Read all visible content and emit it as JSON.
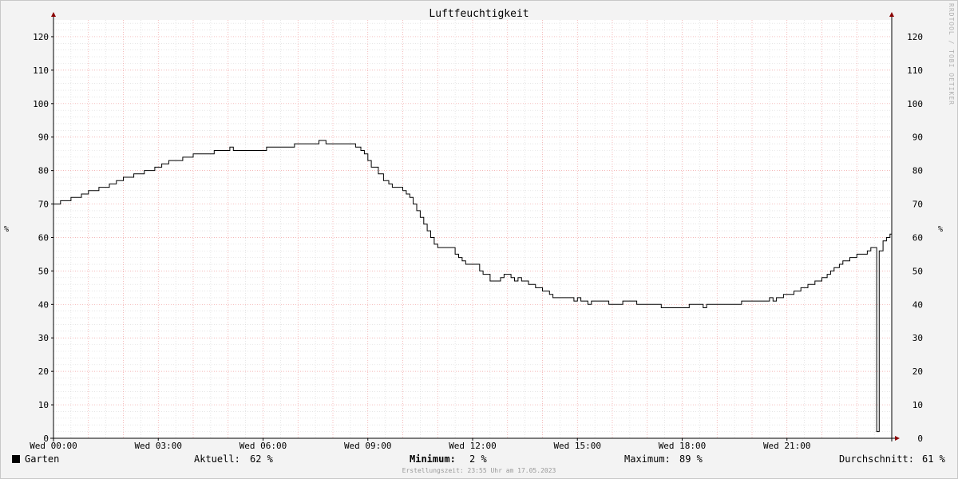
{
  "chart_data": {
    "type": "line",
    "title": "Luftfeuchtigkeit",
    "ylabel": "%",
    "ylim": [
      0,
      125
    ],
    "y_ticks": [
      0,
      10,
      20,
      30,
      40,
      50,
      60,
      70,
      80,
      90,
      100,
      110,
      120
    ],
    "x_range_hours": [
      0,
      24
    ],
    "x_ticks": [
      {
        "hour": 0,
        "label": "Wed 00:00"
      },
      {
        "hour": 3,
        "label": "Wed 03:00"
      },
      {
        "hour": 6,
        "label": "Wed 06:00"
      },
      {
        "hour": 9,
        "label": "Wed 09:00"
      },
      {
        "hour": 12,
        "label": "Wed 12:00"
      },
      {
        "hour": 15,
        "label": "Wed 15:00"
      },
      {
        "hour": 18,
        "label": "Wed 18:00"
      },
      {
        "hour": 21,
        "label": "Wed 21:00"
      }
    ],
    "grid": true,
    "series": [
      {
        "name": "Garten",
        "color": "#000000",
        "points": [
          [
            0.0,
            70
          ],
          [
            0.2,
            71
          ],
          [
            0.5,
            72
          ],
          [
            0.8,
            73
          ],
          [
            1.0,
            74
          ],
          [
            1.3,
            75
          ],
          [
            1.6,
            76
          ],
          [
            1.8,
            77
          ],
          [
            2.0,
            78
          ],
          [
            2.3,
            79
          ],
          [
            2.6,
            80
          ],
          [
            2.9,
            81
          ],
          [
            3.1,
            82
          ],
          [
            3.3,
            83
          ],
          [
            3.7,
            84
          ],
          [
            4.0,
            85
          ],
          [
            4.5,
            85
          ],
          [
            4.6,
            86
          ],
          [
            5.0,
            86
          ],
          [
            5.05,
            87
          ],
          [
            5.15,
            86
          ],
          [
            6.0,
            86
          ],
          [
            6.1,
            87
          ],
          [
            6.8,
            87
          ],
          [
            6.9,
            88
          ],
          [
            7.5,
            88
          ],
          [
            7.6,
            89
          ],
          [
            7.8,
            88
          ],
          [
            8.5,
            88
          ],
          [
            8.65,
            87
          ],
          [
            8.8,
            86
          ],
          [
            8.9,
            85
          ],
          [
            9.0,
            83
          ],
          [
            9.1,
            81
          ],
          [
            9.3,
            79
          ],
          [
            9.45,
            77
          ],
          [
            9.6,
            76
          ],
          [
            9.7,
            75
          ],
          [
            9.9,
            75
          ],
          [
            10.0,
            74
          ],
          [
            10.1,
            73
          ],
          [
            10.2,
            72
          ],
          [
            10.3,
            70
          ],
          [
            10.4,
            68
          ],
          [
            10.5,
            66
          ],
          [
            10.6,
            64
          ],
          [
            10.7,
            62
          ],
          [
            10.8,
            60
          ],
          [
            10.9,
            58
          ],
          [
            11.0,
            57
          ],
          [
            11.4,
            57
          ],
          [
            11.5,
            55
          ],
          [
            11.6,
            54
          ],
          [
            11.7,
            53
          ],
          [
            11.8,
            52
          ],
          [
            12.1,
            52
          ],
          [
            12.2,
            50
          ],
          [
            12.3,
            49
          ],
          [
            12.5,
            47
          ],
          [
            12.7,
            47
          ],
          [
            12.8,
            48
          ],
          [
            12.9,
            49
          ],
          [
            13.1,
            48
          ],
          [
            13.2,
            47
          ],
          [
            13.3,
            48
          ],
          [
            13.4,
            47
          ],
          [
            13.6,
            46
          ],
          [
            13.8,
            45
          ],
          [
            14.0,
            44
          ],
          [
            14.2,
            43
          ],
          [
            14.3,
            42
          ],
          [
            14.8,
            42
          ],
          [
            14.9,
            41
          ],
          [
            15.0,
            42
          ],
          [
            15.1,
            41
          ],
          [
            15.2,
            41
          ],
          [
            15.3,
            40
          ],
          [
            15.4,
            41
          ],
          [
            15.8,
            41
          ],
          [
            15.9,
            40
          ],
          [
            16.2,
            40
          ],
          [
            16.3,
            41
          ],
          [
            16.6,
            41
          ],
          [
            16.7,
            40
          ],
          [
            17.3,
            40
          ],
          [
            17.4,
            39
          ],
          [
            18.1,
            39
          ],
          [
            18.2,
            40
          ],
          [
            18.5,
            40
          ],
          [
            18.6,
            39
          ],
          [
            18.7,
            40
          ],
          [
            19.6,
            40
          ],
          [
            19.7,
            41
          ],
          [
            20.4,
            41
          ],
          [
            20.5,
            42
          ],
          [
            20.6,
            41
          ],
          [
            20.7,
            42
          ],
          [
            20.9,
            43
          ],
          [
            21.2,
            44
          ],
          [
            21.4,
            45
          ],
          [
            21.6,
            46
          ],
          [
            21.8,
            47
          ],
          [
            22.0,
            48
          ],
          [
            22.15,
            49
          ],
          [
            22.25,
            50
          ],
          [
            22.35,
            51
          ],
          [
            22.5,
            52
          ],
          [
            22.6,
            53
          ],
          [
            22.8,
            54
          ],
          [
            23.0,
            55
          ],
          [
            23.2,
            55
          ],
          [
            23.3,
            56
          ],
          [
            23.4,
            57
          ],
          [
            23.55,
            57
          ],
          [
            23.57,
            2
          ],
          [
            23.62,
            2
          ],
          [
            23.64,
            56
          ],
          [
            23.75,
            59
          ],
          [
            23.85,
            60
          ],
          [
            23.95,
            61
          ],
          [
            24.0,
            62
          ]
        ]
      }
    ]
  },
  "watermark": "RRDTOOL / TOBI OETIKER",
  "legend": {
    "series_name": "Garten",
    "current_label": "Aktuell:",
    "current_value": "62 %",
    "min_label": "Minimum:",
    "min_value": "2 %",
    "max_label": "Maximum:",
    "max_value": "89 %",
    "avg_label": "Durchschnitt:",
    "avg_value": "61 %"
  },
  "footer": "Erstellungszeit: 23:55 Uhr am 17.05.2023"
}
